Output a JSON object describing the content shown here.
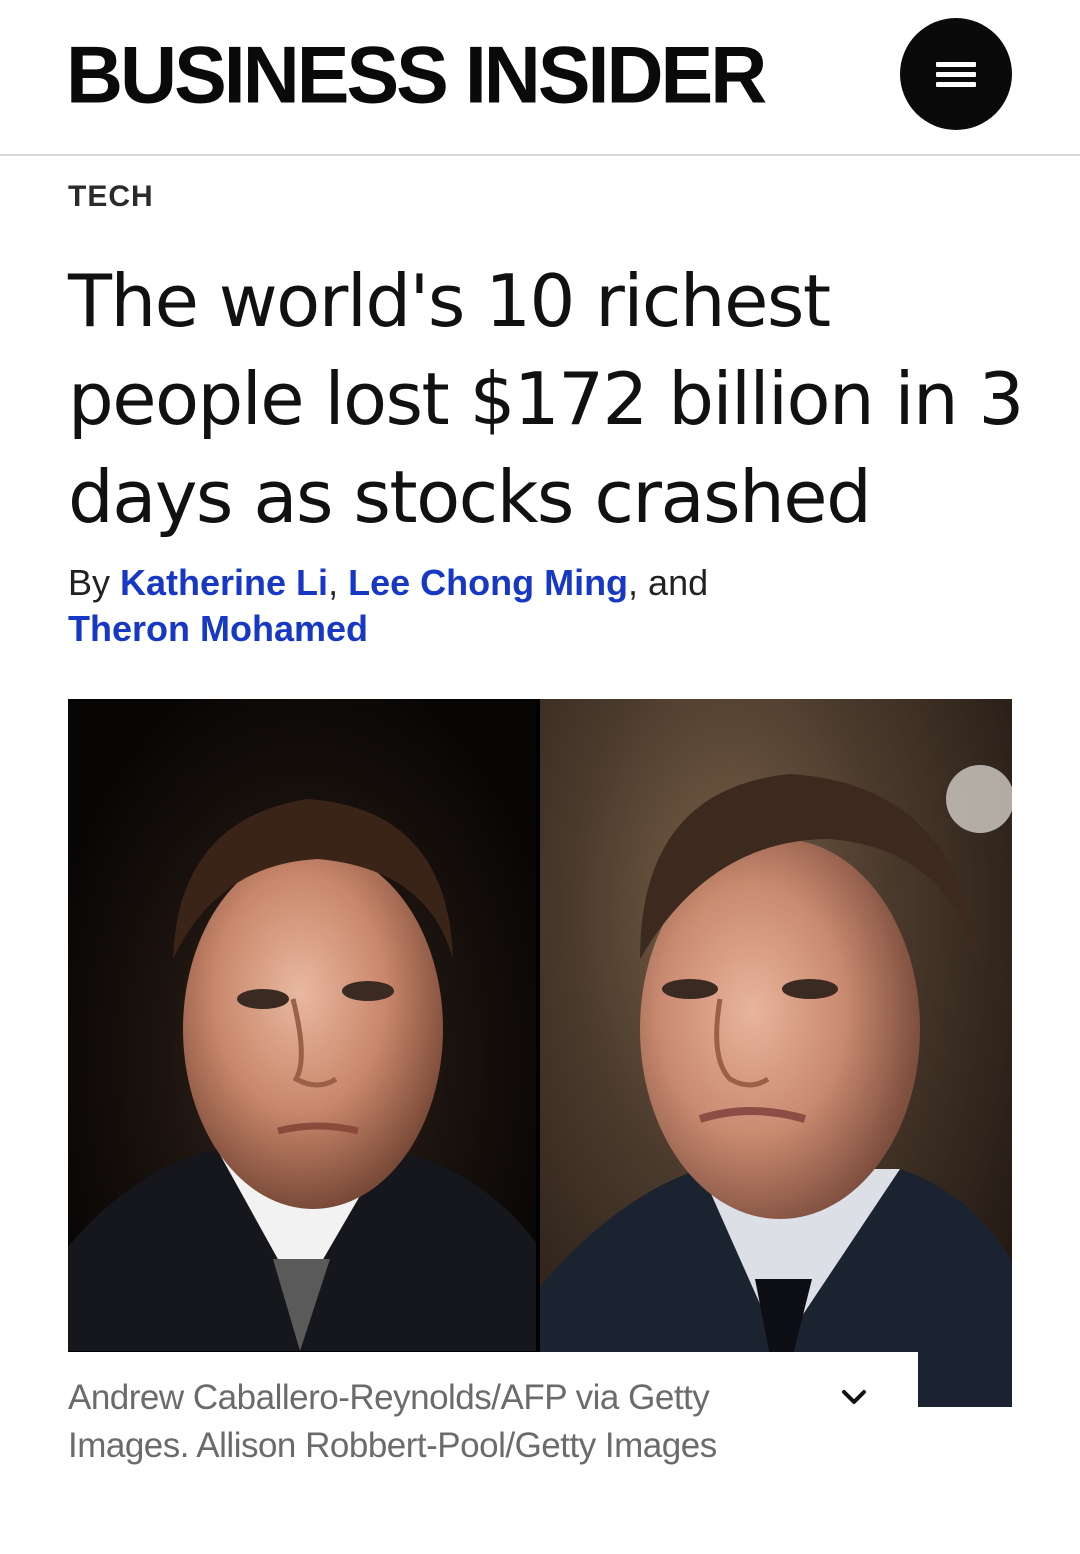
{
  "header": {
    "logo_text": "BUSINESS INSIDER",
    "menu_icon": "hamburger-menu-icon"
  },
  "article": {
    "section": "TECH",
    "headline": "The world's 10 richest people lost $172 billion in 3 days as stocks crashed",
    "byline": {
      "prefix": "By ",
      "authors": [
        "Katherine Li",
        "Lee Chong Ming",
        "Theron Mohamed"
      ],
      "sep1": ", ",
      "sep2": ", and ",
      "link_color": "#1638c4"
    },
    "photo": {
      "caption": "Andrew Caballero-Reynolds/AFP via Getty Images. Allison Robbert-Pool/Getty Images",
      "expand_icon": "chevron-down-icon"
    }
  }
}
